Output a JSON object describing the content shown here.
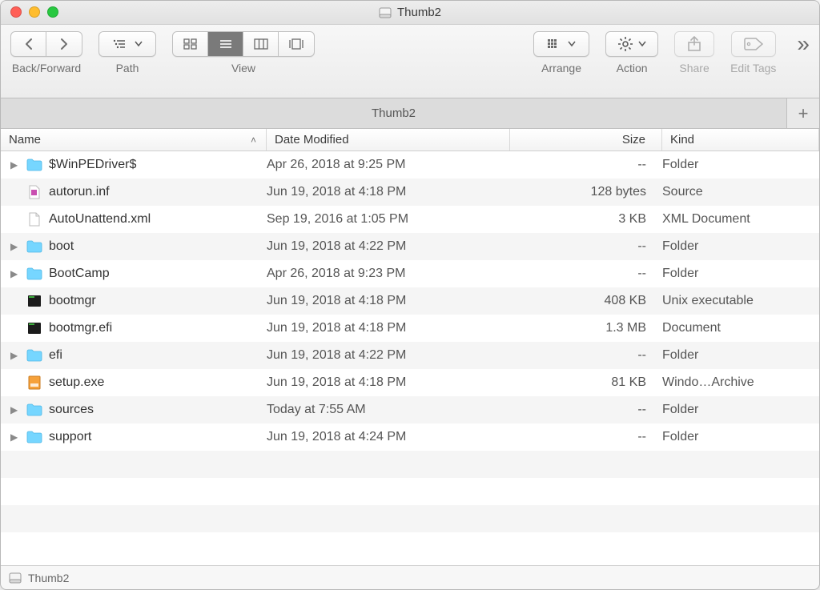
{
  "window": {
    "title": "Thumb2"
  },
  "toolbar": {
    "back_forward": "Back/Forward",
    "path": "Path",
    "view": "View",
    "arrange": "Arrange",
    "action": "Action",
    "share": "Share",
    "edit_tags": "Edit Tags",
    "more": "»"
  },
  "tabs": {
    "active": "Thumb2",
    "add": "+"
  },
  "columns": {
    "name": "Name",
    "date": "Date Modified",
    "size": "Size",
    "kind": "Kind",
    "sort_indicator": "˄"
  },
  "files": [
    {
      "expandable": true,
      "icon": "folder",
      "name": "$WinPEDriver$",
      "date": "Apr 26, 2018 at 9:25 PM",
      "size": "--",
      "kind": "Folder"
    },
    {
      "expandable": false,
      "icon": "doc-src",
      "name": "autorun.inf",
      "date": "Jun 19, 2018 at 4:18 PM",
      "size": "128 bytes",
      "kind": "Source"
    },
    {
      "expandable": false,
      "icon": "doc",
      "name": "AutoUnattend.xml",
      "date": "Sep 19, 2016 at 1:05 PM",
      "size": "3 KB",
      "kind": "XML Document"
    },
    {
      "expandable": true,
      "icon": "folder",
      "name": "boot",
      "date": "Jun 19, 2018 at 4:22 PM",
      "size": "--",
      "kind": "Folder"
    },
    {
      "expandable": true,
      "icon": "folder",
      "name": "BootCamp",
      "date": "Apr 26, 2018 at 9:23 PM",
      "size": "--",
      "kind": "Folder"
    },
    {
      "expandable": false,
      "icon": "exec",
      "name": "bootmgr",
      "date": "Jun 19, 2018 at 4:18 PM",
      "size": "408 KB",
      "kind": "Unix executable"
    },
    {
      "expandable": false,
      "icon": "exec",
      "name": "bootmgr.efi",
      "date": "Jun 19, 2018 at 4:18 PM",
      "size": "1.3 MB",
      "kind": "Document"
    },
    {
      "expandable": true,
      "icon": "folder",
      "name": "efi",
      "date": "Jun 19, 2018 at 4:22 PM",
      "size": "--",
      "kind": "Folder"
    },
    {
      "expandable": false,
      "icon": "exe",
      "name": "setup.exe",
      "date": "Jun 19, 2018 at 4:18 PM",
      "size": "81 KB",
      "kind": "Windo…Archive"
    },
    {
      "expandable": true,
      "icon": "folder",
      "name": "sources",
      "date": "Today at 7:55 AM",
      "size": "--",
      "kind": "Folder"
    },
    {
      "expandable": true,
      "icon": "folder",
      "name": "support",
      "date": "Jun 19, 2018 at 4:24 PM",
      "size": "--",
      "kind": "Folder"
    }
  ],
  "blank_rows": 3,
  "pathbar": {
    "location": "Thumb2"
  }
}
